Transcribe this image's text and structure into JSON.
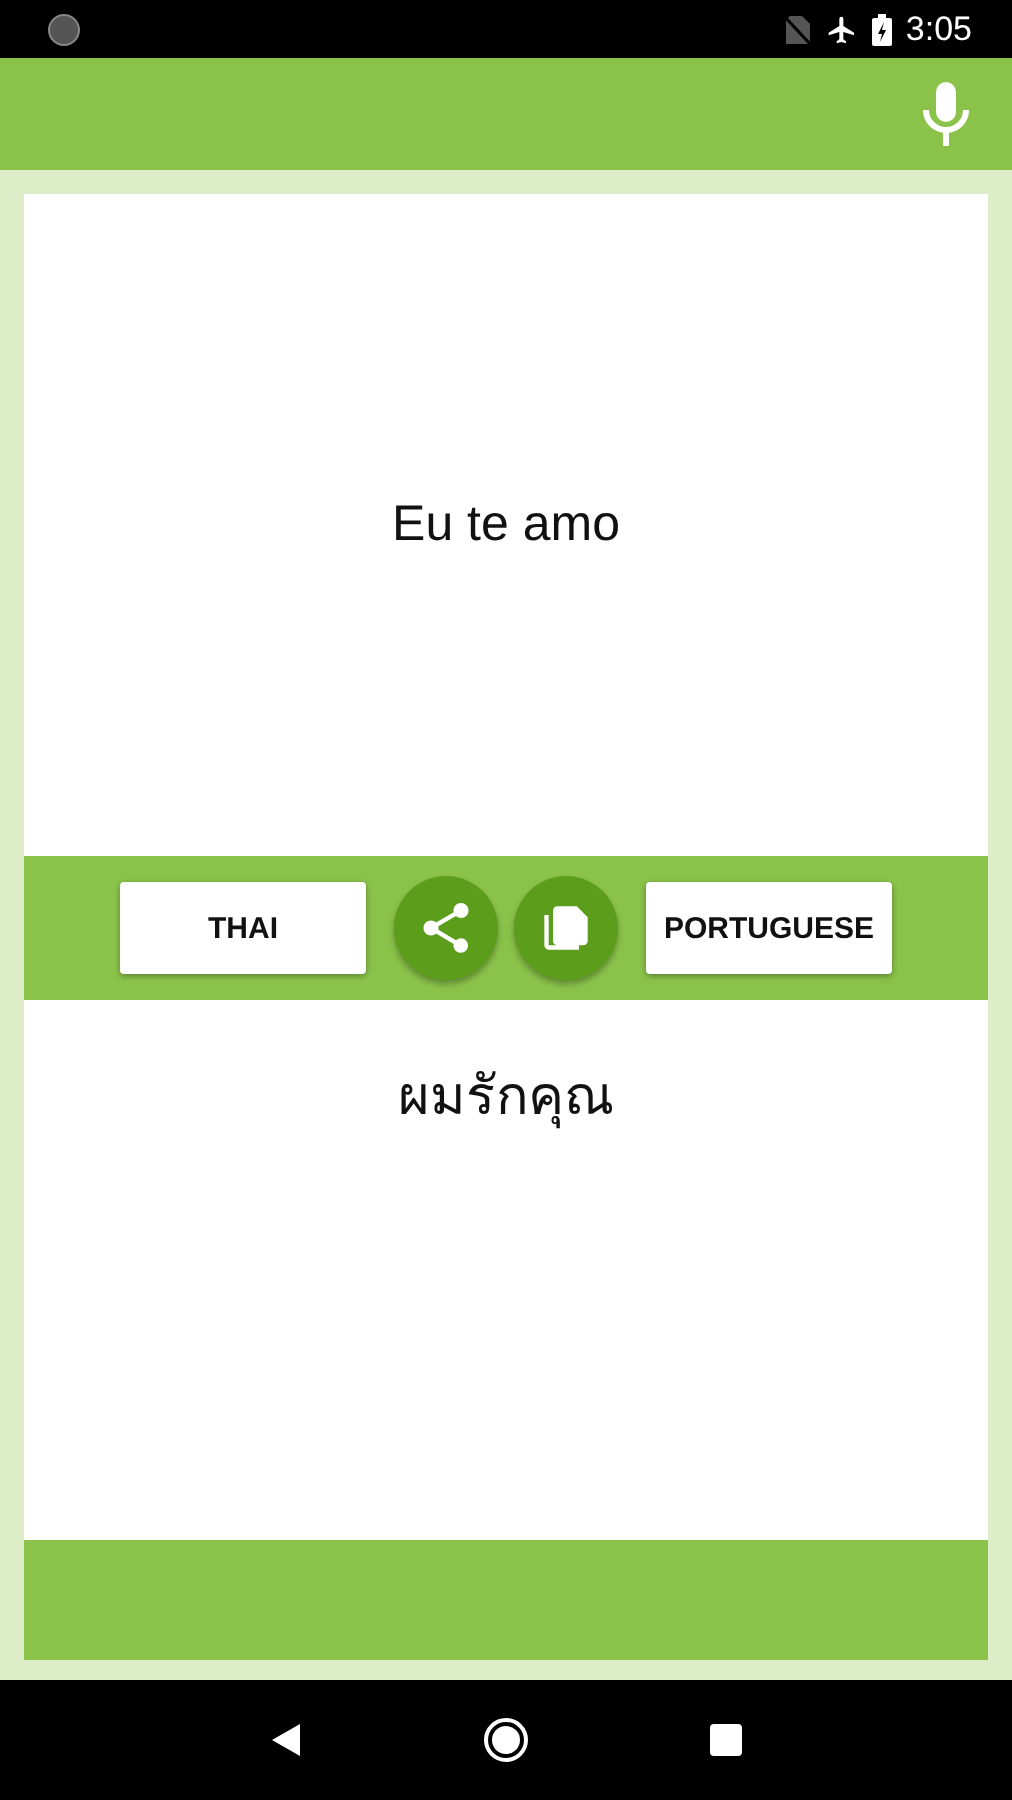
{
  "status_bar": {
    "time": "3:05"
  },
  "source_text": "Eu te amo",
  "translation_text": "ผมรักคุณ",
  "language_buttons": [
    {
      "label": "THAI"
    },
    {
      "label": "PORTUGUESE"
    }
  ]
}
